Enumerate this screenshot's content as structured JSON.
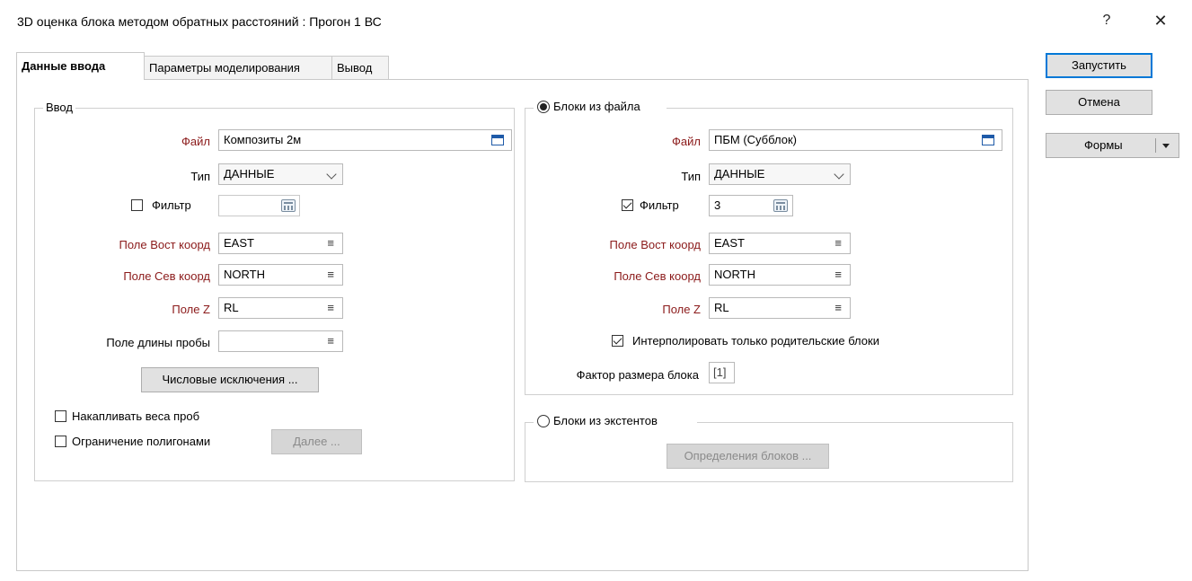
{
  "window": {
    "title": "3D оценка блока методом обратных расстояний : Прогон 1 ВС",
    "help": "?",
    "close": "✕"
  },
  "tabs": [
    {
      "label": "Данные ввода",
      "active": true
    },
    {
      "label": "Параметры моделирования",
      "active": false
    },
    {
      "label": "Вывод",
      "active": false
    }
  ],
  "actions": {
    "run": "Запустить",
    "cancel": "Отмена",
    "forms": "Формы"
  },
  "input": {
    "legend": "Ввод",
    "file_label": "Файл",
    "file_value": "Композиты 2м",
    "type_label": "Тип",
    "type_value": "ДАННЫЕ",
    "filter_label": "Фильтр",
    "filter_checked": false,
    "filter_value": "",
    "east_label": "Поле Вост коорд",
    "east_value": "EAST",
    "north_label": "Поле Сев коорд",
    "north_value": "NORTH",
    "z_label": "Поле Z",
    "z_value": "RL",
    "length_label": "Поле длины пробы",
    "length_value": "",
    "exclusions_button": "Числовые исключения ...",
    "accumulate_label": "Накапливать веса проб",
    "accumulate_checked": false,
    "polygon_label": "Ограничение полигонами",
    "polygon_checked": false,
    "next_button": "Далее ..."
  },
  "blocks_file": {
    "legend": "Блоки из файла",
    "selected": true,
    "file_label": "Файл",
    "file_value": "ПБМ (Субблок)",
    "type_label": "Тип",
    "type_value": "ДАННЫЕ",
    "filter_label": "Фильтр",
    "filter_checked": true,
    "filter_value": "3",
    "east_label": "Поле Вост коорд",
    "east_value": "EAST",
    "north_label": "Поле Сев коорд",
    "north_value": "NORTH",
    "z_label": "Поле Z",
    "z_value": "RL",
    "parent_only_label": "Интерполировать только родительские блоки",
    "parent_only_checked": true,
    "size_factor_label": "Фактор размера блока",
    "size_factor_value": "[1]"
  },
  "blocks_extents": {
    "legend": "Блоки из экстентов",
    "selected": false,
    "definitions_button": "Определения блоков ..."
  },
  "icons": {
    "menu": "≡"
  }
}
